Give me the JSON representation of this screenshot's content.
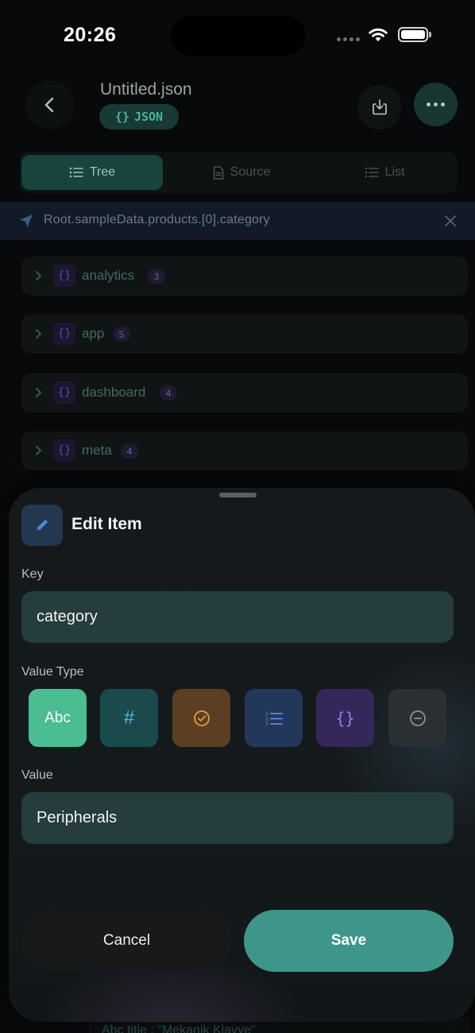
{
  "status_bar": {
    "time": "20:26"
  },
  "header": {
    "file_name": "Untitled.json",
    "format_badge": "JSON",
    "format_badge_icon": "{}"
  },
  "view_tabs": [
    {
      "label": "Tree",
      "icon": "list-icon",
      "active": true
    },
    {
      "label": "Source",
      "icon": "document-icon",
      "active": false
    },
    {
      "label": "List",
      "icon": "list-icon",
      "active": false
    }
  ],
  "breadcrumb": {
    "path": "Root.sampleData.products.[0].category"
  },
  "tree": {
    "items": [
      {
        "key": "analytics",
        "count": "3"
      },
      {
        "key": "app",
        "count": "5"
      },
      {
        "key": "dashboard",
        "count": "4"
      },
      {
        "key": "meta",
        "count": "4"
      }
    ],
    "peek_row": "Abc title : \"Mekanik Klavye\""
  },
  "sheet": {
    "title": "Edit Item",
    "key_label": "Key",
    "key_value": "category",
    "value_type_label": "Value Type",
    "value_types": [
      {
        "name": "string",
        "glyph": "Abc",
        "selected": true
      },
      {
        "name": "number",
        "glyph": "#",
        "selected": false
      },
      {
        "name": "boolean",
        "glyph": "check-circle-icon",
        "selected": false
      },
      {
        "name": "array",
        "glyph": "numbered-list-icon",
        "selected": false
      },
      {
        "name": "object",
        "glyph": "{}",
        "selected": false
      },
      {
        "name": "null",
        "glyph": "minus-circle-icon",
        "selected": false
      }
    ],
    "value_label": "Value",
    "value_value": "Peripherals",
    "cancel_label": "Cancel",
    "save_label": "Save"
  },
  "colors": {
    "accent": "#3e968b",
    "selected_type": "#4bbd92",
    "breadcrumb_bar": "#111a26"
  }
}
